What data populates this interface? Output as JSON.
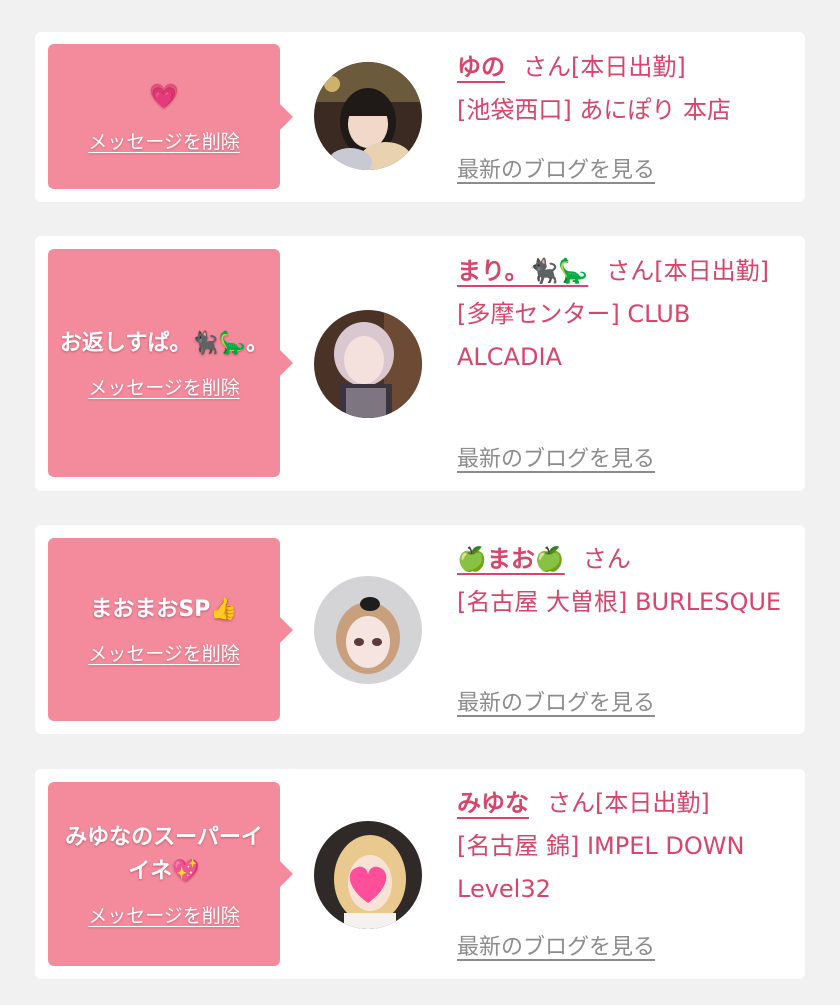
{
  "cards": [
    {
      "bubble_emoji": "💗",
      "bubble_text": "",
      "delete_label": "メッセージを削除",
      "name": "ゆの",
      "name_suffix": "さん[本日出勤]",
      "shop": "[池袋西口] あにぽり 本店",
      "blog_link": "最新のブログを見る"
    },
    {
      "bubble_emoji": "",
      "bubble_text": "お返しすぱ。🐈‍⬛🦕。",
      "delete_label": "メッセージを削除",
      "name": "まり。🐈‍⬛🦕",
      "name_suffix": "さん[本日出勤]",
      "shop": "[多摩センター] CLUB ALCADIA",
      "blog_link": "最新のブログを見る"
    },
    {
      "bubble_emoji": "",
      "bubble_text": "まおまおSP👍",
      "delete_label": "メッセージを削除",
      "name": "🍏まお🍏",
      "name_suffix": "さん",
      "shop": "[名古屋 大曽根] BURLESQUE",
      "blog_link": "最新のブログを見る"
    },
    {
      "bubble_emoji": "",
      "bubble_text": "みゆなのスーパーイイネ💖",
      "delete_label": "メッセージを削除",
      "name": "みゆな",
      "name_suffix": "さん[本日出勤]",
      "shop": "[名古屋 錦] IMPEL DOWN Level32",
      "blog_link": "最新のブログを見る"
    }
  ],
  "colors": {
    "page_background": "#f1f1f2",
    "card_background": "#ffffff",
    "bubble": "#f48b9d",
    "accent_text": "#d8456a",
    "blog_link": "#8c8c8c"
  }
}
